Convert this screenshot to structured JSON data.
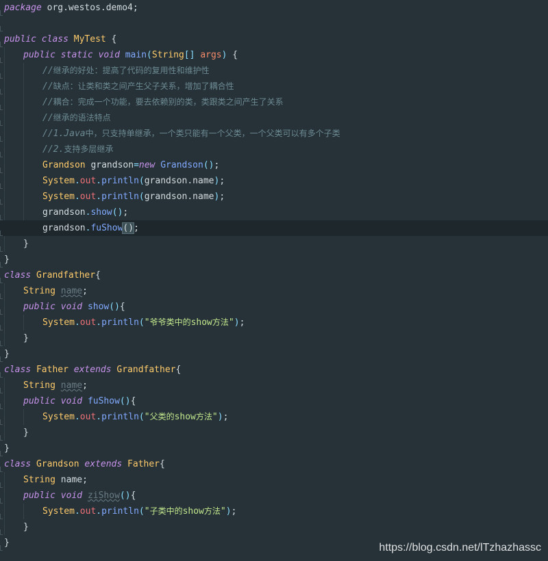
{
  "watermark": "https://blog.csdn.net/lTzhazhassc",
  "lines": [
    {
      "indent": 0,
      "tokens": [
        [
          "kw",
          "package"
        ],
        [
          "plain",
          " org.westos.demo4;"
        ]
      ]
    },
    {
      "indent": 0,
      "tokens": []
    },
    {
      "indent": 0,
      "tokens": [
        [
          "kw",
          "public"
        ],
        [
          "plain",
          " "
        ],
        [
          "kw",
          "class"
        ],
        [
          "plain",
          " "
        ],
        [
          "cls",
          "MyTest"
        ],
        [
          "plain",
          " {"
        ]
      ]
    },
    {
      "indent": 1,
      "tokens": [
        [
          "kw",
          "public"
        ],
        [
          "plain",
          " "
        ],
        [
          "kw",
          "static"
        ],
        [
          "plain",
          " "
        ],
        [
          "kw",
          "void"
        ],
        [
          "plain",
          " "
        ],
        [
          "fn",
          "main"
        ],
        [
          "punc",
          "("
        ],
        [
          "cls",
          "String"
        ],
        [
          "punc",
          "[]"
        ],
        [
          "plain",
          " "
        ],
        [
          "param",
          "args"
        ],
        [
          "punc",
          ")"
        ],
        [
          "plain",
          " {"
        ]
      ]
    },
    {
      "indent": 2,
      "tokens": [
        [
          "com",
          "//继承的好处：提高了代码的复用性和维护性"
        ]
      ]
    },
    {
      "indent": 2,
      "tokens": [
        [
          "com",
          "//缺点：让类和类之间产生父子关系，增加了耦合性"
        ]
      ]
    },
    {
      "indent": 2,
      "tokens": [
        [
          "com",
          "//耦合：完成一个功能，要去依赖别的类，类跟类之间产生了关系"
        ]
      ]
    },
    {
      "indent": 2,
      "tokens": [
        [
          "com",
          "//继承的语法特点"
        ]
      ]
    },
    {
      "indent": 2,
      "tokens": [
        [
          "com",
          "//1.Java中，只支持单继承，一个类只能有一个父类，一个父类可以有多个子类"
        ]
      ]
    },
    {
      "indent": 2,
      "tokens": [
        [
          "com",
          "//2.支持多层继承"
        ]
      ]
    },
    {
      "indent": 2,
      "tokens": [
        [
          "cls",
          "Grandson"
        ],
        [
          "plain",
          " grandson"
        ],
        [
          "punc",
          "="
        ],
        [
          "kw",
          "new"
        ],
        [
          "plain",
          " "
        ],
        [
          "fn",
          "Grandson"
        ],
        [
          "punc",
          "()"
        ],
        [
          "plain",
          ";"
        ]
      ]
    },
    {
      "indent": 2,
      "tokens": [
        [
          "cls",
          "System"
        ],
        [
          "punc",
          "."
        ],
        [
          "field",
          "out"
        ],
        [
          "punc",
          "."
        ],
        [
          "fn",
          "println"
        ],
        [
          "punc",
          "("
        ],
        [
          "plain",
          "grandson.name"
        ],
        [
          "punc",
          ")"
        ],
        [
          "plain",
          ";"
        ]
      ]
    },
    {
      "indent": 2,
      "tokens": [
        [
          "cls",
          "System"
        ],
        [
          "punc",
          "."
        ],
        [
          "field",
          "out"
        ],
        [
          "punc",
          "."
        ],
        [
          "fn",
          "println"
        ],
        [
          "punc",
          "("
        ],
        [
          "plain",
          "grandson.name"
        ],
        [
          "punc",
          ")"
        ],
        [
          "plain",
          ";"
        ]
      ]
    },
    {
      "indent": 2,
      "tokens": [
        [
          "plain",
          "grandson"
        ],
        [
          "punc",
          "."
        ],
        [
          "fn",
          "show"
        ],
        [
          "punc",
          "()"
        ],
        [
          "plain",
          ";"
        ]
      ]
    },
    {
      "indent": 2,
      "current": true,
      "tokens": [
        [
          "plain",
          "grandson"
        ],
        [
          "punc",
          "."
        ],
        [
          "fn",
          "fuShow"
        ],
        [
          "bracket",
          "()"
        ],
        [
          "plain",
          ";"
        ]
      ]
    },
    {
      "indent": 1,
      "tokens": [
        [
          "plain",
          "}"
        ]
      ]
    },
    {
      "indent": 0,
      "tokens": [
        [
          "plain",
          "}"
        ]
      ]
    },
    {
      "indent": 0,
      "tokens": [
        [
          "kw",
          "class"
        ],
        [
          "plain",
          " "
        ],
        [
          "cls",
          "Grandfather"
        ],
        [
          "plain",
          "{"
        ]
      ]
    },
    {
      "indent": 1,
      "tokens": [
        [
          "cls",
          "String"
        ],
        [
          "plain",
          " "
        ],
        [
          "unused",
          "name"
        ],
        [
          "plain",
          ";"
        ]
      ]
    },
    {
      "indent": 1,
      "tokens": [
        [
          "kw",
          "public"
        ],
        [
          "plain",
          " "
        ],
        [
          "kw",
          "void"
        ],
        [
          "plain",
          " "
        ],
        [
          "fn",
          "show"
        ],
        [
          "punc",
          "()"
        ],
        [
          "plain",
          "{"
        ]
      ]
    },
    {
      "indent": 2,
      "tokens": [
        [
          "cls",
          "System"
        ],
        [
          "punc",
          "."
        ],
        [
          "field",
          "out"
        ],
        [
          "punc",
          "."
        ],
        [
          "fn",
          "println"
        ],
        [
          "punc",
          "("
        ],
        [
          "str",
          "\"爷爷类中的show方法\""
        ],
        [
          "punc",
          ")"
        ],
        [
          "plain",
          ";"
        ]
      ]
    },
    {
      "indent": 1,
      "tokens": [
        [
          "plain",
          "}"
        ]
      ]
    },
    {
      "indent": 0,
      "tokens": [
        [
          "plain",
          "}"
        ]
      ]
    },
    {
      "indent": 0,
      "tokens": [
        [
          "kw",
          "class"
        ],
        [
          "plain",
          " "
        ],
        [
          "cls",
          "Father"
        ],
        [
          "plain",
          " "
        ],
        [
          "kw",
          "extends"
        ],
        [
          "plain",
          " "
        ],
        [
          "cls",
          "Grandfather"
        ],
        [
          "plain",
          "{"
        ]
      ]
    },
    {
      "indent": 1,
      "tokens": [
        [
          "cls",
          "String"
        ],
        [
          "plain",
          " "
        ],
        [
          "unused",
          "name"
        ],
        [
          "plain",
          ";"
        ]
      ]
    },
    {
      "indent": 1,
      "tokens": [
        [
          "kw",
          "public"
        ],
        [
          "plain",
          " "
        ],
        [
          "kw",
          "void"
        ],
        [
          "plain",
          " "
        ],
        [
          "fn",
          "fuShow"
        ],
        [
          "punc",
          "()"
        ],
        [
          "plain",
          "{"
        ]
      ]
    },
    {
      "indent": 2,
      "tokens": [
        [
          "cls",
          "System"
        ],
        [
          "punc",
          "."
        ],
        [
          "field",
          "out"
        ],
        [
          "punc",
          "."
        ],
        [
          "fn",
          "println"
        ],
        [
          "punc",
          "("
        ],
        [
          "str",
          "\"父类的show方法\""
        ],
        [
          "punc",
          ")"
        ],
        [
          "plain",
          ";"
        ]
      ]
    },
    {
      "indent": 1,
      "tokens": [
        [
          "plain",
          "}"
        ]
      ]
    },
    {
      "indent": 0,
      "tokens": [
        [
          "plain",
          "}"
        ]
      ]
    },
    {
      "indent": 0,
      "tokens": [
        [
          "kw",
          "class"
        ],
        [
          "plain",
          " "
        ],
        [
          "cls",
          "Grandson"
        ],
        [
          "plain",
          " "
        ],
        [
          "kw",
          "extends"
        ],
        [
          "plain",
          " "
        ],
        [
          "cls",
          "Father"
        ],
        [
          "plain",
          "{"
        ]
      ]
    },
    {
      "indent": 1,
      "tokens": [
        [
          "cls",
          "String"
        ],
        [
          "plain",
          " name;"
        ]
      ]
    },
    {
      "indent": 1,
      "tokens": [
        [
          "kw",
          "public"
        ],
        [
          "plain",
          " "
        ],
        [
          "kw",
          "void"
        ],
        [
          "plain",
          " "
        ],
        [
          "unused",
          "ziShow"
        ],
        [
          "punc",
          "()"
        ],
        [
          "plain",
          "{"
        ]
      ]
    },
    {
      "indent": 2,
      "tokens": [
        [
          "cls",
          "System"
        ],
        [
          "punc",
          "."
        ],
        [
          "field",
          "out"
        ],
        [
          "punc",
          "."
        ],
        [
          "fn",
          "println"
        ],
        [
          "punc",
          "("
        ],
        [
          "str",
          "\"子类中的show方法\""
        ],
        [
          "punc",
          ")"
        ],
        [
          "plain",
          ";"
        ]
      ]
    },
    {
      "indent": 1,
      "tokens": [
        [
          "plain",
          "}"
        ]
      ]
    },
    {
      "indent": 0,
      "tokens": [
        [
          "plain",
          "}"
        ]
      ]
    }
  ]
}
